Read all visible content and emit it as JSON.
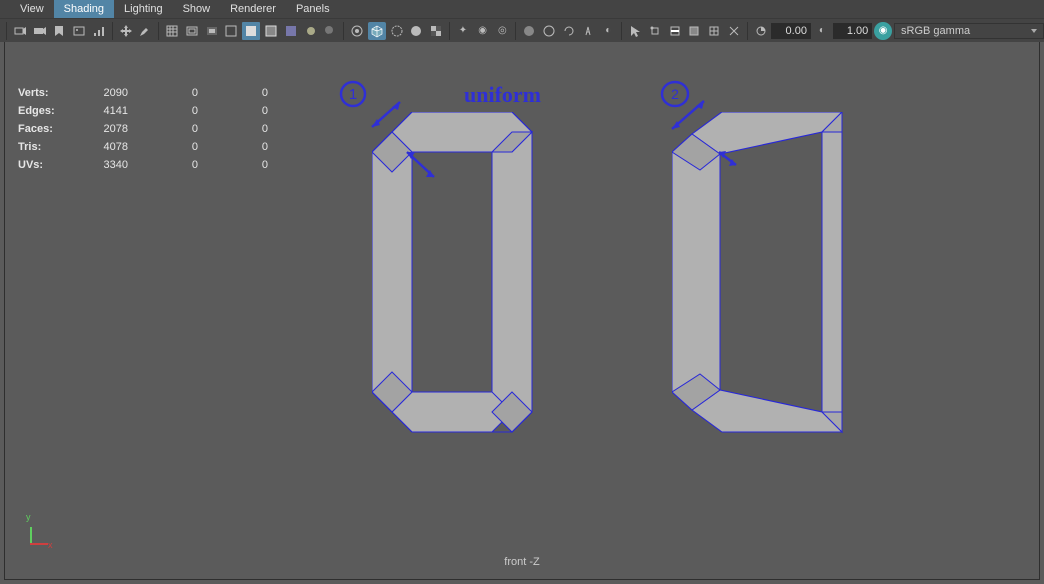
{
  "menubar": {
    "items": [
      "View",
      "Shading",
      "Lighting",
      "Show",
      "Renderer",
      "Panels"
    ],
    "active_index": 1
  },
  "toolbar": {
    "value1": "0.00",
    "value2": "1.00",
    "colorspace": "sRGB gamma"
  },
  "stats": {
    "rows": [
      {
        "label": "Verts:",
        "a": "2090",
        "b": "0",
        "c": "0"
      },
      {
        "label": "Edges:",
        "a": "4141",
        "b": "0",
        "c": "0"
      },
      {
        "label": "Faces:",
        "a": "2078",
        "b": "0",
        "c": "0"
      },
      {
        "label": "Tris:",
        "a": "4078",
        "b": "0",
        "c": "0"
      },
      {
        "label": "UVs:",
        "a": "3340",
        "b": "0",
        "c": "0"
      }
    ]
  },
  "viewport": {
    "label": "front -Z",
    "axis_y": "y",
    "axis_x": "x"
  },
  "annotations": {
    "one": "1",
    "two": "2",
    "word": "uniform"
  }
}
